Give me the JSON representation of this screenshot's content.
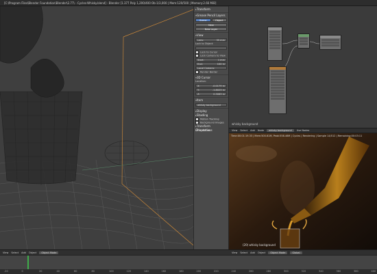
{
  "window": {
    "title": "[C:\\Program Files\\Blender Foundation\\Blender\\2.77\\ - Cycles-Whisky.blend] - Blender [1.377 Poly 1,200/400 Ob-1/3,000 | Mem:120/500 | Memory:2.66 MiB]"
  },
  "npanel": {
    "transform_label": "Transform",
    "grease_pencil_label": "Grease Pencil Layers",
    "scene_btn": "Scene",
    "object_btn": "Object",
    "new_btn": "New",
    "new_layer_btn": "New Layer",
    "view_label": "View",
    "lens_label": "Lens:",
    "lens_value": "35 mm",
    "lock_to_object_label": "Lock to Object:",
    "lock_to_cursor": "Lock to Cursor",
    "lock_camera_to_view": "Lock Camera to View",
    "clip_start_label": "Start:",
    "clip_start_value": "1 mm",
    "clip_end_label": "End:",
    "clip_end_value": "100 m",
    "local_camera": "Local Camera:",
    "render_border": "Render Border",
    "cursor_label": "3D Cursor",
    "location_label": "Location:",
    "loc_x_label": "X:",
    "loc_x": "-0.0179 m",
    "loc_y_label": "Y:",
    "loc_y": "-1.8023 m",
    "loc_z_label": "Z:",
    "loc_z": "0.3063 m",
    "item_label": "Item",
    "item_name": "whisky background",
    "display_label": "Display",
    "shading_label": "Shading",
    "motion_tracking": "Motion Tracking",
    "bg_images": "Background Images",
    "transform_orient": "Transform Orientations",
    "properties_label": "Properties"
  },
  "nodeeditor": {
    "object_name": "whisky background"
  },
  "render_header": {
    "items": [
      "View",
      "Select",
      "Add",
      "Node"
    ],
    "slot_field": "whisky background",
    "use_nodes": "Use Nodes"
  },
  "renderview": {
    "info": "Time:00:01:19.33 | Mem:500.61M, Peak:558.46M | Cycles | Rendering | Sample 14/512 | Remaining:00:03:11",
    "object_label": "(20) whisky background"
  },
  "bottom_header_left": {
    "items": [
      "View",
      "Select",
      "Add",
      "Object",
      "Object Mode"
    ]
  },
  "bottom_header_right": {
    "items": [
      "View",
      "Select",
      "Add",
      "Object",
      "Object Mode",
      "Global"
    ]
  },
  "timeline": {
    "ticks": [
      "-20",
      "0",
      "20",
      "40",
      "60",
      "80",
      "100",
      "120",
      "140",
      "160",
      "180",
      "200",
      "220",
      "240",
      "260",
      "280",
      "300",
      "320",
      "340",
      "360",
      "380",
      "400"
    ],
    "current_frame": "20",
    "playhead_color": "#3fae4a"
  }
}
